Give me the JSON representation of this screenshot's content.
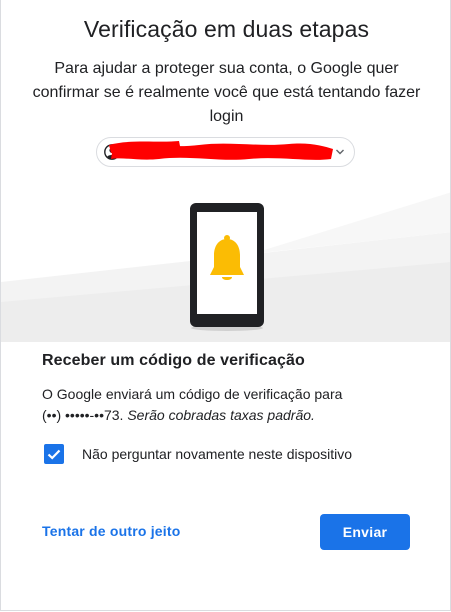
{
  "page": {
    "title": "Verificação em duas etapas",
    "subtitle": "Para ajudar a proteger sua conta, o Google quer confirmar se é realmente você que está tentando fazer login"
  },
  "account": {
    "email": "",
    "avatar_icon": "account-circle-icon",
    "chevron_icon": "chevron-down-icon",
    "redaction_color": "#ff0000"
  },
  "illustration": {
    "device": "phone-icon",
    "notification_icon": "bell-icon",
    "bell_color": "#fbbc04"
  },
  "method": {
    "title": "Receber um código de verificação",
    "desc_prefix": "O Google enviará um código de verificação para",
    "phone_masked": "(••) •••••-••73.",
    "desc_suffix": "Serão cobradas taxas padrão."
  },
  "remember": {
    "checked": true,
    "label": "Não perguntar novamente neste dispositivo"
  },
  "actions": {
    "other_way_label": "Tentar de outro jeito",
    "send_label": "Enviar"
  },
  "colors": {
    "accent": "#1a73e8",
    "text": "#202124",
    "border": "#dadce0"
  }
}
